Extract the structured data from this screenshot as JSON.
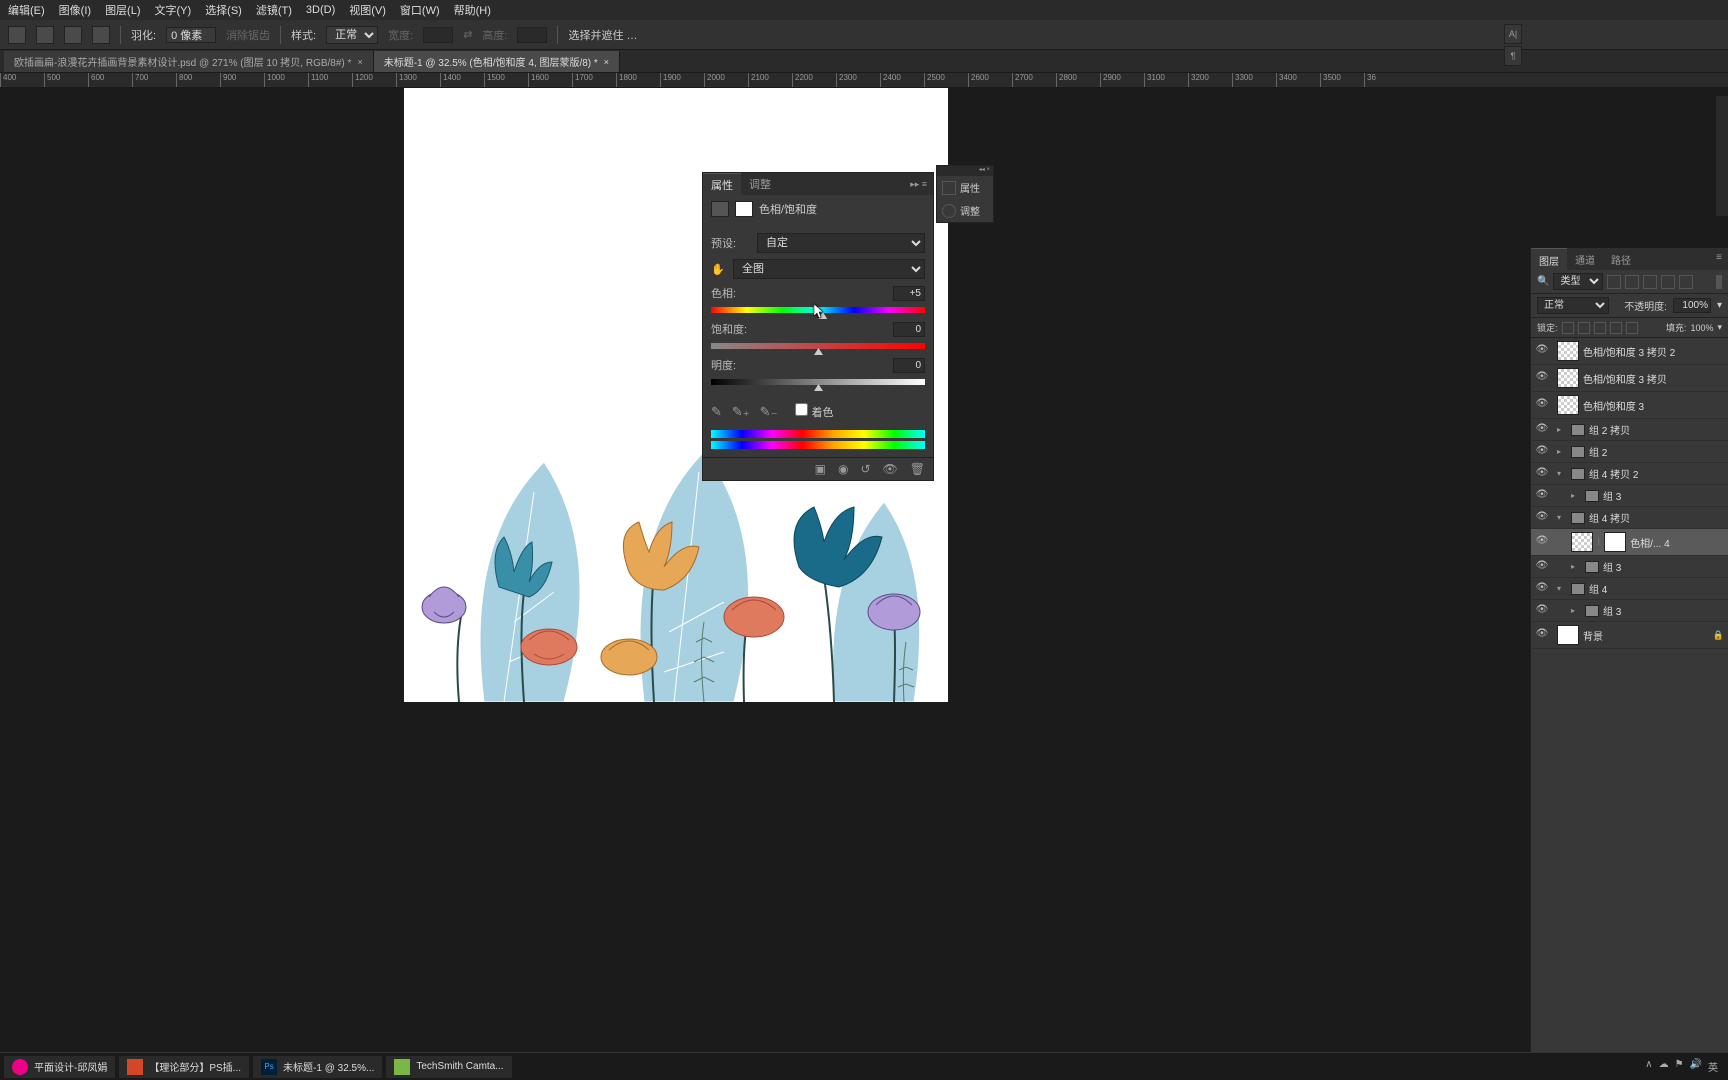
{
  "menu": [
    "编辑(E)",
    "图像(I)",
    "图层(L)",
    "文字(Y)",
    "选择(S)",
    "滤镜(T)",
    "3D(D)",
    "视图(V)",
    "窗口(W)",
    "帮助(H)"
  ],
  "options": {
    "feather_label": "羽化:",
    "feather_val": "0 像素",
    "antialias": "消除锯齿",
    "style_label": "样式:",
    "style_val": "正常",
    "width_label": "宽度:",
    "height_label": "高度:",
    "selectmask": "选择并遮住 …"
  },
  "tabs": [
    {
      "label": "欧插画扁-浪漫花卉插画背景素材设计.psd @ 271% (图层 10 拷贝, RGB/8#) *",
      "active": false
    },
    {
      "label": "未标题-1 @ 32.5% (色相/饱和度 4, 图层蒙版/8) *",
      "active": true
    }
  ],
  "ruler_ticks": [
    "400",
    "500",
    "600",
    "700",
    "800",
    "900",
    "1000",
    "1100",
    "1200",
    "1300",
    "1400",
    "1500",
    "1600",
    "1700",
    "1800",
    "1900",
    "2000",
    "2100",
    "2200",
    "2300",
    "2400",
    "2500",
    "2600",
    "2700",
    "2800",
    "2900",
    "3100",
    "3200",
    "3300",
    "3400",
    "3500",
    "36"
  ],
  "props": {
    "tab1": "属性",
    "tab2": "调整",
    "adj_name": "色相/饱和度",
    "preset_label": "预设:",
    "preset_val": "自定",
    "scope_val": "全图",
    "hue_label": "色相:",
    "hue_val": "+5",
    "sat_label": "饱和度:",
    "sat_val": "0",
    "light_label": "明度:",
    "light_val": "0",
    "colorize": "着色"
  },
  "side_cluster": {
    "t1": "属性",
    "t2": "调整"
  },
  "layers": {
    "tabs": [
      "图层",
      "通道",
      "路径"
    ],
    "filter_val": "类型",
    "blend_val": "正常",
    "opacity_label": "不透明度:",
    "opacity_val": "100%",
    "lock_label": "锁定:",
    "fill_label": "填充:",
    "fill_val": "100%",
    "items": [
      {
        "eye": true,
        "indent": 0,
        "type": "adj",
        "name": "色相/饱和度 3 拷贝 2"
      },
      {
        "eye": true,
        "indent": 0,
        "type": "adj",
        "name": "色相/饱和度 3 拷贝"
      },
      {
        "eye": true,
        "indent": 0,
        "type": "adj",
        "name": "色相/饱和度 3"
      },
      {
        "eye": true,
        "indent": 0,
        "type": "group",
        "open": false,
        "name": "组 2 拷贝"
      },
      {
        "eye": true,
        "indent": 0,
        "type": "group",
        "open": false,
        "name": "组 2"
      },
      {
        "eye": true,
        "indent": 0,
        "type": "group",
        "open": true,
        "name": "组 4 拷贝 2"
      },
      {
        "eye": true,
        "indent": 1,
        "type": "group",
        "open": false,
        "name": "组 3"
      },
      {
        "eye": true,
        "indent": 0,
        "type": "group",
        "open": true,
        "name": "组 4 拷贝"
      },
      {
        "eye": true,
        "indent": 1,
        "type": "adj",
        "sel": true,
        "name": "色相/... 4"
      },
      {
        "eye": true,
        "indent": 1,
        "type": "group",
        "open": false,
        "name": "组 3"
      },
      {
        "eye": true,
        "indent": 0,
        "type": "group",
        "open": true,
        "name": "组 4"
      },
      {
        "eye": true,
        "indent": 1,
        "type": "group",
        "open": false,
        "name": "组 3"
      },
      {
        "eye": true,
        "indent": 0,
        "type": "layer",
        "name": "背景",
        "locked": true
      }
    ]
  },
  "taskbar": {
    "items": [
      {
        "name": "平面设计-邱凤娟",
        "color": "#e08"
      },
      {
        "name": "【理论部分】PS插...",
        "color": "#d24726"
      },
      {
        "name": "未标题-1 @ 32.5%...",
        "color": "#001e36"
      },
      {
        "name": "TechSmith Camta...",
        "color": "#7ab648"
      }
    ]
  }
}
